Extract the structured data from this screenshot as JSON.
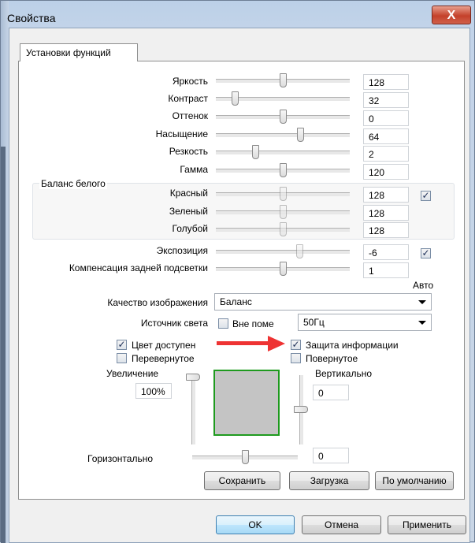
{
  "window": {
    "title": "Свойства",
    "close_label": "X"
  },
  "tab": {
    "label": "Установки функций"
  },
  "sliders": [
    {
      "label": "Яркость",
      "value": "128"
    },
    {
      "label": "Контраст",
      "value": "32"
    },
    {
      "label": "Оттенок",
      "value": "0"
    },
    {
      "label": "Насыщение",
      "value": "64"
    },
    {
      "label": "Резкость",
      "value": "2"
    },
    {
      "label": "Гамма",
      "value": "120"
    }
  ],
  "white_balance": {
    "title": "Баланс белого",
    "items": [
      {
        "label": "Красный",
        "value": "128"
      },
      {
        "label": "Зеленый",
        "value": "128"
      },
      {
        "label": "Голубой",
        "value": "128"
      }
    ],
    "auto_checked": true
  },
  "exposure": {
    "label": "Экспозиция",
    "value": "-6",
    "auto_checked": true
  },
  "backlight": {
    "label": "Компенсация задней подсветки",
    "value": "1"
  },
  "auto_label": "Авто",
  "quality": {
    "label": "Качество изображения",
    "value": "Баланс"
  },
  "light": {
    "label": "Источник света",
    "outdoor_label": "Вне поме",
    "outdoor_checked": false,
    "freq": "50Гц"
  },
  "checks": {
    "color": {
      "label": "Цвет доступен",
      "checked": true
    },
    "flip": {
      "label": "Перевернутое",
      "checked": false
    },
    "protect": {
      "label": "Защита информации",
      "checked": true
    },
    "rotate": {
      "label": "Повернутое",
      "checked": false
    }
  },
  "zoom": {
    "label": "Увеличение",
    "value": "100%"
  },
  "vertical": {
    "label": "Вертикально",
    "value": "0"
  },
  "horizontal": {
    "label": "Горизонтально",
    "value": "0"
  },
  "buttons": {
    "save": "Сохранить",
    "load": "Загрузка",
    "default": "По умолчанию",
    "ok": "OK",
    "cancel": "Отмена",
    "apply": "Применить"
  },
  "colors": {
    "arrow": "#ee3333",
    "preview_border": "#1e9a1e",
    "preview_fill": "#c4c4c4"
  }
}
